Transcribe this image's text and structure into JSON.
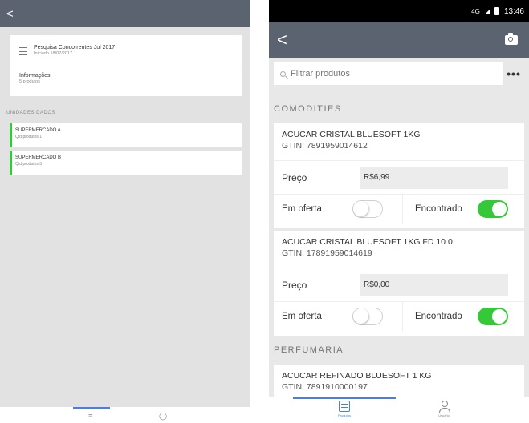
{
  "left": {
    "back": "<",
    "survey": {
      "title": "Pesquisa Concorrentes Jul 2017",
      "subtitle": "Iniciado 18/07/2017"
    },
    "info": {
      "title": "Informações",
      "subtitle": "5 produtos"
    },
    "section_label": "UNIDADES DADOS",
    "stores": [
      {
        "name": "SUPERMERCADO A",
        "sub": "Qtd produtos 1"
      },
      {
        "name": "SUPERMERCADO B",
        "sub": "Qtd produtos 3"
      }
    ]
  },
  "right": {
    "status": {
      "network": "4G",
      "time": "13:46"
    },
    "back": "<",
    "search": {
      "placeholder": "Filtrar produtos"
    },
    "more": "•••",
    "categories": [
      "COMODITIES",
      "PERFUMARIA"
    ],
    "products": [
      {
        "name": "ACUCAR CRISTAL BLUESOFT 1KG",
        "gtin": "GTIN: 7891959014612",
        "price_label": "Preço",
        "price": "R$6,99",
        "offer_label": "Em oferta",
        "offer": false,
        "found_label": "Encontrado",
        "found": true
      },
      {
        "name": "ACUCAR CRISTAL BLUESOFT 1KG FD 10.0",
        "gtin": "GTIN: 17891959014619",
        "price_label": "Preço",
        "price": "R$0,00",
        "offer_label": "Em oferta",
        "offer": false,
        "found_label": "Encontrado",
        "found": true
      },
      {
        "name": "ACUCAR REFINADO BLUESOFT 1 KG",
        "gtin": "GTIN: 7891910000197"
      }
    ],
    "tabs": [
      {
        "label": "Produtos",
        "icon": "list-icon",
        "active": true
      },
      {
        "label": "Usuário",
        "icon": "person-icon",
        "active": false
      }
    ],
    "accent_color": "#35c93a",
    "appbar_color": "#5b6270",
    "tab_active_color": "#4a7ee0"
  }
}
